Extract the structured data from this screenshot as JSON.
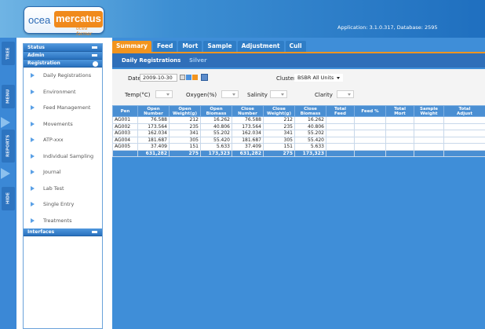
{
  "app": {
    "logo_left": "ocea",
    "logo_right": "mercatus",
    "logo_sub": "ocea farmer",
    "info": "Application: 3.1.0.317, Database: 2595"
  },
  "side_tabs": [
    "TREE",
    "MENU",
    "REPORTS",
    "HIDE"
  ],
  "sidebar": {
    "sections": [
      {
        "label": "Status"
      },
      {
        "label": "Admin"
      },
      {
        "label": "Registration"
      }
    ],
    "items": [
      {
        "label": "Daily Registrations"
      },
      {
        "label": "Environment"
      },
      {
        "label": "Feed Management"
      },
      {
        "label": "Movements"
      },
      {
        "label": "ATP-xxx"
      },
      {
        "label": "Individual Sampling"
      },
      {
        "label": "Journal"
      },
      {
        "label": "Lab Test"
      },
      {
        "label": "Single Entry"
      },
      {
        "label": "Treatments"
      }
    ],
    "footer": "Interfaces"
  },
  "tabs": [
    "Summary",
    "Feed",
    "Mort",
    "Sample",
    "Adjustment",
    "Cull"
  ],
  "active_tab": "Summary",
  "subtabs": [
    "Daily Registrations",
    "Silver"
  ],
  "filters": {
    "date_label": "Date",
    "date_value": "2009-10-30",
    "cluster_label": "Cluster",
    "cluster_value": "BSBR All Units",
    "temp_label": "Temp(°C)",
    "oxygen_label": "Oxygen(%)",
    "salinity_label": "Salinity",
    "clarity_label": "Clarity"
  },
  "table": {
    "headers": [
      {
        "line1": "Pen",
        "line2": ""
      },
      {
        "line1": "Open",
        "line2": "Number"
      },
      {
        "line1": "Open",
        "line2": "Weight(g)"
      },
      {
        "line1": "Open",
        "line2": "Biomass"
      },
      {
        "line1": "Close",
        "line2": "Number"
      },
      {
        "line1": "Close",
        "line2": "Weight(g)"
      },
      {
        "line1": "Close",
        "line2": "Biomass"
      },
      {
        "line1": "Total",
        "line2": "Feed"
      },
      {
        "line1": "Feed %",
        "line2": ""
      },
      {
        "line1": "Total",
        "line2": "Mort"
      },
      {
        "line1": "Sample",
        "line2": "Weight"
      },
      {
        "line1": "Total",
        "line2": "Adjust"
      }
    ],
    "rows": [
      [
        "AG001",
        "76.588",
        "212",
        "16.262",
        "76.588",
        "212",
        "16.262",
        "",
        "",
        "",
        "",
        ""
      ],
      [
        "AG002",
        "173.564",
        "235",
        "40.806",
        "173.564",
        "235",
        "40.806",
        "",
        "",
        "",
        "",
        ""
      ],
      [
        "AG003",
        "162.034",
        "341",
        "55.202",
        "162.034",
        "341",
        "55.202",
        "",
        "",
        "",
        "",
        ""
      ],
      [
        "AG004",
        "181.687",
        "305",
        "55.420",
        "181.687",
        "305",
        "55.420",
        "",
        "",
        "",
        "",
        ""
      ],
      [
        "AG005",
        "37.409",
        "151",
        "5.633",
        "37.409",
        "151",
        "5.633",
        "",
        "",
        "",
        "",
        ""
      ]
    ],
    "totals": [
      "",
      "631,282",
      "275",
      "173,323",
      "631,282",
      "275",
      "173,323",
      "",
      "",
      "",
      "",
      ""
    ]
  },
  "colors": {
    "accent": "#f2941e",
    "header_blue": "#2f6fb9",
    "content_blue": "#3f8ed8"
  }
}
